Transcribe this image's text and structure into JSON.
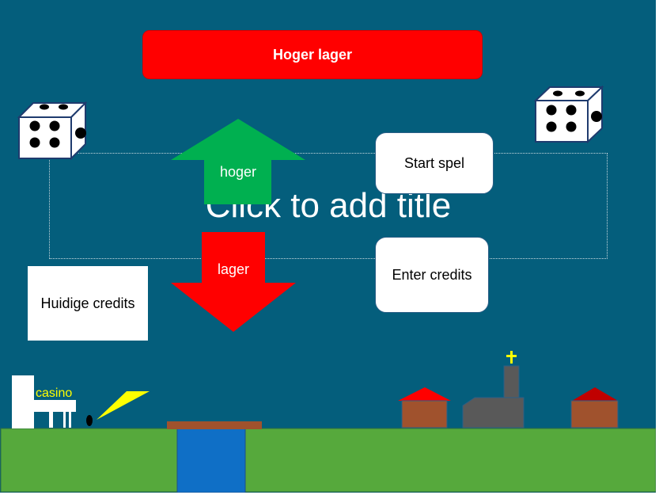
{
  "slide": {
    "header_button": "Hoger lager",
    "title_placeholder": "Click to add title",
    "start_button": "Start spel",
    "enter_button": "Enter credits",
    "credits_box": "Huidige credits",
    "up_arrow_label": "hoger",
    "down_arrow_label": "lager",
    "casino_label": "casino"
  },
  "colors": {
    "background": "#045e7c",
    "header": "#ff0000",
    "up_arrow": "#00b050",
    "down_arrow": "#ff0000",
    "grass": "#56a93c",
    "water": "#0f6fc6",
    "bridge": "#a0522d",
    "roof": "#ff0000",
    "house": "#a0522d",
    "church": "#595959",
    "casino_sign": "#ffff00"
  },
  "icons": [
    "dice-icon",
    "dice-icon"
  ]
}
